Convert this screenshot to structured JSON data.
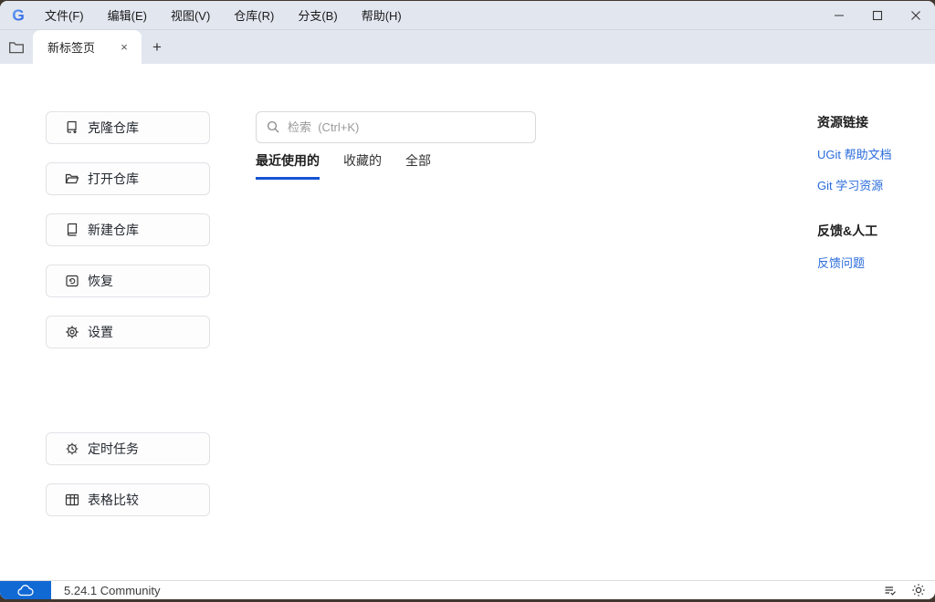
{
  "titlebar": {
    "logo_letter": "G",
    "menu_items": [
      "文件(F)",
      "编辑(E)",
      "视图(V)",
      "仓库(R)",
      "分支(B)",
      "帮助(H)"
    ]
  },
  "tabbar": {
    "active_tab": "新标签页",
    "new_tab_button": "+"
  },
  "sidebar": {
    "buttons": [
      {
        "icon": "repo-clone-icon",
        "label": "克隆仓库"
      },
      {
        "icon": "folder-open-icon",
        "label": "打开仓库"
      },
      {
        "icon": "repo-new-icon",
        "label": "新建仓库"
      },
      {
        "icon": "restore-icon",
        "label": "恢复"
      },
      {
        "icon": "gear-icon",
        "label": "设置"
      },
      {
        "icon": "timer-task-icon",
        "label": "定时任务"
      },
      {
        "icon": "table-compare-icon",
        "label": "表格比较"
      }
    ]
  },
  "main": {
    "search_placeholder": "检索  (Ctrl+K)",
    "filter_tabs": [
      {
        "label": "最近使用的",
        "active": true
      },
      {
        "label": "收藏的",
        "active": false
      },
      {
        "label": "全部",
        "active": false
      }
    ]
  },
  "right_panel": {
    "resources_title": "资源链接",
    "resource_links": [
      "UGit 帮助文档",
      "Git 学习资源"
    ],
    "feedback_title": "反馈&人工",
    "feedback_links": [
      "反馈问题"
    ]
  },
  "statusbar": {
    "version": "5.24.1 Community"
  },
  "colors": {
    "chrome_bg": "#e2e6ef",
    "tab_underline_blue": "#1653d4",
    "link_blue": "#2a6bdb",
    "status_box_blue": "#1169d4",
    "logo_blue": "#2f6fe8"
  }
}
